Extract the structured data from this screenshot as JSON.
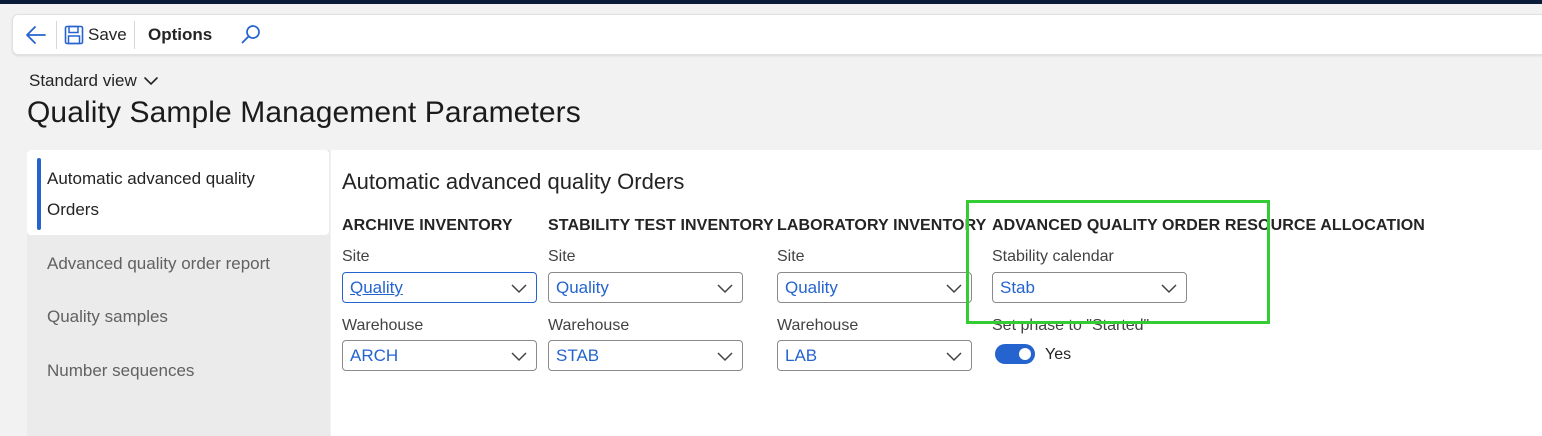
{
  "toolbar": {
    "back_icon": "arrow-left-icon",
    "save_icon": "floppy-disk-icon",
    "save_label": "Save",
    "options_label": "Options",
    "search_icon": "search-icon"
  },
  "header": {
    "view_label": "Standard view",
    "view_icon": "chevron-down-icon",
    "title": "Quality Sample Management Parameters"
  },
  "sidebar": {
    "items": [
      {
        "label_line1": "Automatic advanced quality",
        "label_line2": "Orders",
        "active": true
      },
      {
        "label": "Advanced quality order report"
      },
      {
        "label": "Quality samples"
      },
      {
        "label": "Number sequences"
      }
    ]
  },
  "main": {
    "section_title": "Automatic advanced quality Orders",
    "groups": [
      {
        "heading": "ARCHIVE INVENTORY",
        "site_label": "Site",
        "site_value": "Quality",
        "warehouse_label": "Warehouse",
        "warehouse_value": "ARCH"
      },
      {
        "heading": "STABILITY TEST INVENTORY",
        "site_label": "Site",
        "site_value": "Quality",
        "warehouse_label": "Warehouse",
        "warehouse_value": "STAB"
      },
      {
        "heading": "LABORATORY INVENTORY",
        "site_label": "Site",
        "site_value": "Quality",
        "warehouse_label": "Warehouse",
        "warehouse_value": "LAB"
      },
      {
        "heading": "ADVANCED QUALITY ORDER RESOURCE ALLOCATION",
        "calendar_label": "Stability calendar",
        "calendar_value": "Stab",
        "phase_label": "Set phase to \"Started\"",
        "phase_value": "Yes",
        "phase_on": true
      }
    ]
  },
  "colors": {
    "accent": "#2564cf",
    "highlight": "#33cc33"
  }
}
